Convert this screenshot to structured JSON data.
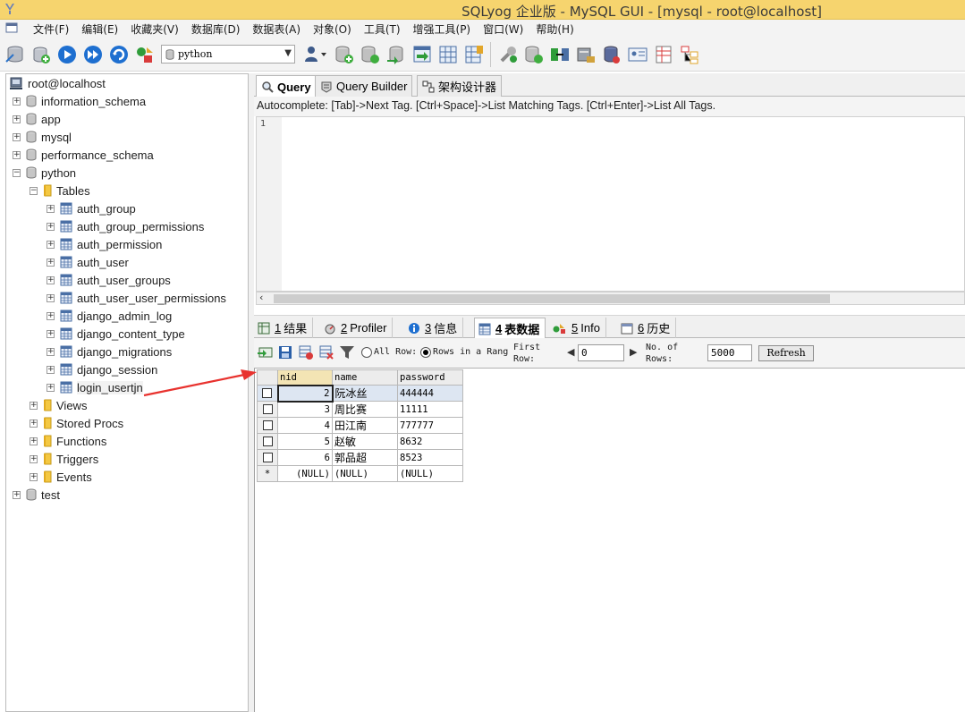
{
  "window": {
    "title": "SQLyog 企业版 - MySQL GUI - [mysql - root@localhost]"
  },
  "menu": [
    "文件(F)",
    "编辑(E)",
    "收藏夹(V)",
    "数据库(D)",
    "数据表(A)",
    "对象(O)",
    "工具(T)",
    "增强工具(P)",
    "窗口(W)",
    "帮助(H)"
  ],
  "toolbar": {
    "database_selector": "python"
  },
  "tree": {
    "root": "root@localhost",
    "databases": [
      "information_schema",
      "app",
      "mysql",
      "performance_schema",
      "python"
    ],
    "python_children": {
      "tables_label": "Tables",
      "tables": [
        "auth_group",
        "auth_group_permissions",
        "auth_permission",
        "auth_user",
        "auth_user_groups",
        "auth_user_user_permissions",
        "django_admin_log",
        "django_content_type",
        "django_migrations",
        "django_session",
        "login_usertjn"
      ],
      "folders": [
        "Views",
        "Stored Procs",
        "Functions",
        "Triggers",
        "Events"
      ]
    },
    "after": [
      "test"
    ]
  },
  "editor": {
    "tabs": [
      "Query",
      "Query Builder",
      "架构设计器"
    ],
    "active_tab": "Query",
    "autocomplete_hint": "Autocomplete: [Tab]->Next Tag. [Ctrl+Space]->List Matching Tags. [Ctrl+Enter]->List All Tags.",
    "line_number": "1"
  },
  "results": {
    "tabs": [
      {
        "num": "1",
        "label": "结果"
      },
      {
        "num": "2",
        "label": "Profiler"
      },
      {
        "num": "3",
        "label": "信息"
      },
      {
        "num": "4",
        "label": "表数据"
      },
      {
        "num": "5",
        "label": "Info"
      },
      {
        "num": "6",
        "label": "历史"
      }
    ],
    "active_tab": "表数据",
    "toolbar": {
      "all_rows": "All Row:",
      "rows_in_range": "Rows in a Rang",
      "first_row_label_1": "First",
      "first_row_label_2": "Row:",
      "first_row_value": "0",
      "no_of_rows_label_1": "No. of",
      "no_of_rows_label_2": "Rows:",
      "no_of_rows_value": "5000",
      "refresh": "Refresh"
    },
    "columns": [
      "nid",
      "name",
      "password"
    ],
    "rows": [
      {
        "nid": "2",
        "name": "阮冰丝",
        "password": "444444"
      },
      {
        "nid": "3",
        "name": "周比赛",
        "password": "11111"
      },
      {
        "nid": "4",
        "name": "田江南",
        "password": "777777"
      },
      {
        "nid": "5",
        "name": "赵敏",
        "password": "8632"
      },
      {
        "nid": "6",
        "name": "郭品超",
        "password": "8523"
      }
    ],
    "new_row": {
      "marker": "*",
      "nid": "(NULL)",
      "name": "(NULL)",
      "password": "(NULL)"
    }
  },
  "colors": {
    "titlebar": "#f6d46e",
    "annotation_arrow": "#e8322e"
  }
}
